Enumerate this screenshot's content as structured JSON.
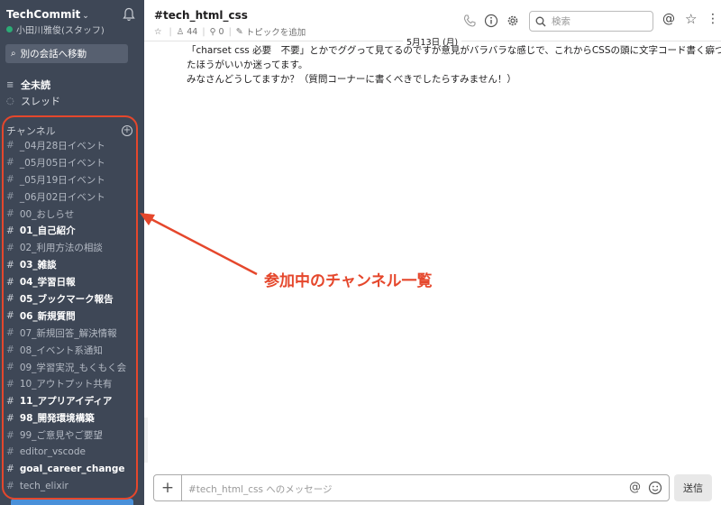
{
  "workspace": {
    "name": "TechCommit",
    "user": "小田川雅俊(スタッフ)",
    "jump_label": "別の会話へ移動"
  },
  "nav": {
    "unread": "全未読",
    "threads": "スレッド"
  },
  "channels_header": "チャンネル",
  "channels": [
    {
      "name": "_04月28日イベント",
      "bold": false
    },
    {
      "name": "_05月05日イベント",
      "bold": false
    },
    {
      "name": "_05月19日イベント",
      "bold": false
    },
    {
      "name": "_06月02日イベント",
      "bold": false
    },
    {
      "name": "00_おしらせ",
      "bold": false
    },
    {
      "name": "01_自己紹介",
      "bold": true
    },
    {
      "name": "02_利用方法の相談",
      "bold": false
    },
    {
      "name": "03_雑談",
      "bold": true
    },
    {
      "name": "04_学習日報",
      "bold": true
    },
    {
      "name": "05_ブックマーク報告",
      "bold": true
    },
    {
      "name": "06_新規質問",
      "bold": true
    },
    {
      "name": "07_新規回答_解決情報",
      "bold": false
    },
    {
      "name": "08_イベント系通知",
      "bold": false
    },
    {
      "name": "09_学習実況_もくもく会",
      "bold": false
    },
    {
      "name": "10_アウトプット共有",
      "bold": false
    },
    {
      "name": "11_アプリアイディア",
      "bold": true
    },
    {
      "name": "98_開発環境構築",
      "bold": true
    },
    {
      "name": "99_ご意見やご要望",
      "bold": false
    },
    {
      "name": "editor_vscode",
      "bold": false
    },
    {
      "name": "goal_career_change",
      "bold": true
    },
    {
      "name": "tech_elixir",
      "bold": false
    }
  ],
  "header": {
    "channel_title": "#tech_html_css",
    "members": "44",
    "pins": "0",
    "add_topic": "トピックを追加",
    "search_placeholder": "検索"
  },
  "date_divider": "5月13日 (月)",
  "message": {
    "line1": "「charset css 必要　不要」とかでググって見てるのですが意見がバラバラな感じで、これからCSSの頭に文字コード書く癖つけ",
    "line2": "たほうがいいか迷ってます。",
    "line3": "みなさんどうしてますか？（質問コーナーに書くべきでしたらすみません！）"
  },
  "annotation": "参加中のチャンネル一覧",
  "composer": {
    "placeholder": "#tech_html_css へのメッセージ",
    "send_label": "送信"
  },
  "colors": {
    "sidebar_bg": "#3e4756",
    "annotation_red": "#e5472c",
    "presence_green": "#2bac76"
  }
}
